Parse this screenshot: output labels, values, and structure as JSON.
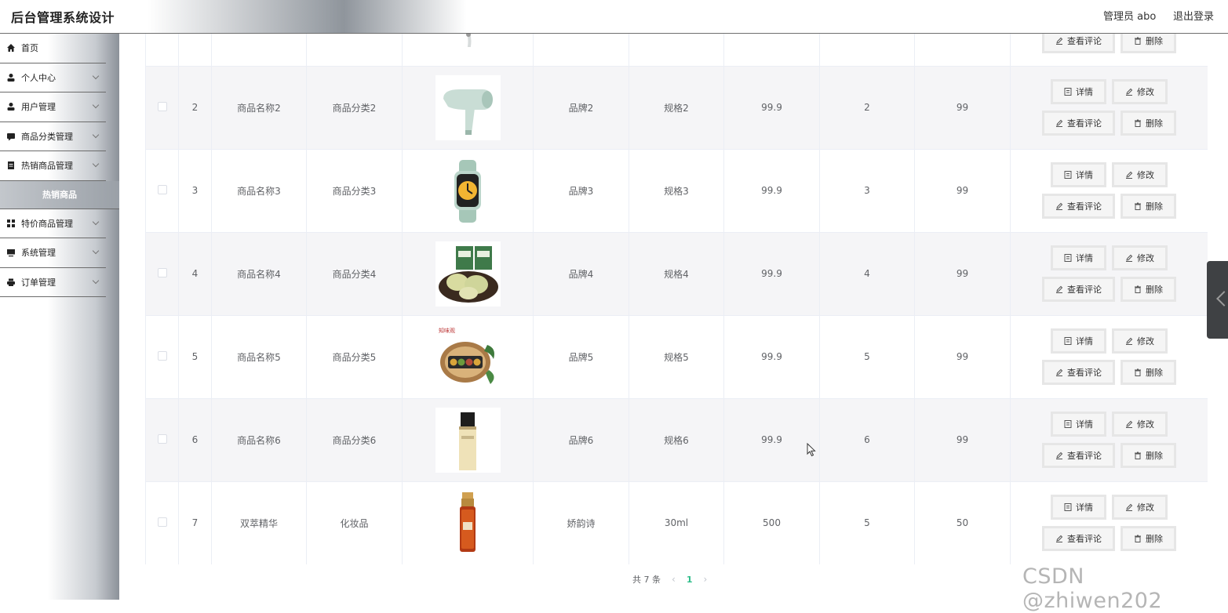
{
  "header": {
    "title": "后台管理系统设计",
    "user": "管理员 abo",
    "logout": "退出登录"
  },
  "sidebar": {
    "items": [
      {
        "label": "首页",
        "icon": "home-icon",
        "expandable": false
      },
      {
        "label": "个人中心",
        "icon": "user-icon",
        "expandable": true
      },
      {
        "label": "用户管理",
        "icon": "user-icon",
        "expandable": true
      },
      {
        "label": "商品分类管理",
        "icon": "chat-icon",
        "expandable": true
      },
      {
        "label": "热销商品管理",
        "icon": "document-icon",
        "expandable": true
      },
      {
        "label": "热销商品",
        "submenu": true
      },
      {
        "label": "特价商品管理",
        "icon": "grid-icon",
        "expandable": true
      },
      {
        "label": "系统管理",
        "icon": "monitor-icon",
        "expandable": true
      },
      {
        "label": "订单管理",
        "icon": "printer-icon",
        "expandable": true
      }
    ]
  },
  "table": {
    "rows": [
      {
        "index": "",
        "name": "",
        "category": "",
        "brand": "",
        "spec": "",
        "price": "",
        "c1": "",
        "c2": "",
        "image": "hair-dryer-partial",
        "partial": true
      },
      {
        "index": "2",
        "name": "商品名称2",
        "category": "商品分类2",
        "brand": "品牌2",
        "spec": "规格2",
        "price": "99.9",
        "c1": "2",
        "c2": "99",
        "image": "hair-dryer"
      },
      {
        "index": "3",
        "name": "商品名称3",
        "category": "商品分类3",
        "brand": "品牌3",
        "spec": "规格3",
        "price": "99.9",
        "c1": "3",
        "c2": "99",
        "image": "smart-watch"
      },
      {
        "index": "4",
        "name": "商品名称4",
        "category": "商品分类4",
        "brand": "品牌4",
        "spec": "规格4",
        "price": "99.9",
        "c1": "4",
        "c2": "99",
        "image": "green-mooncakes"
      },
      {
        "index": "5",
        "name": "商品名称5",
        "category": "商品分类5",
        "brand": "品牌5",
        "spec": "规格5",
        "price": "99.9",
        "c1": "5",
        "c2": "99",
        "image": "mooncake-box"
      },
      {
        "index": "6",
        "name": "商品名称6",
        "category": "商品分类6",
        "brand": "品牌6",
        "spec": "规格6",
        "price": "99.9",
        "c1": "6",
        "c2": "99",
        "image": "lotion-bottle"
      },
      {
        "index": "7",
        "name": "双萃精华",
        "category": "化妆品",
        "brand": "娇韵诗",
        "spec": "30ml",
        "price": "500",
        "c1": "5",
        "c2": "50",
        "image": "serum-bottle"
      }
    ],
    "buttons": {
      "detail": "详情",
      "edit": "修改",
      "comments": "查看评论",
      "delete": "删除"
    }
  },
  "pagination": {
    "total": "共 7 条",
    "current": "1",
    "prev": "‹",
    "next": "›"
  },
  "watermark": "CSDN @zhiwen202",
  "colors": {
    "accent": "#2fbd8a",
    "stripe": "#f5f5f7"
  }
}
